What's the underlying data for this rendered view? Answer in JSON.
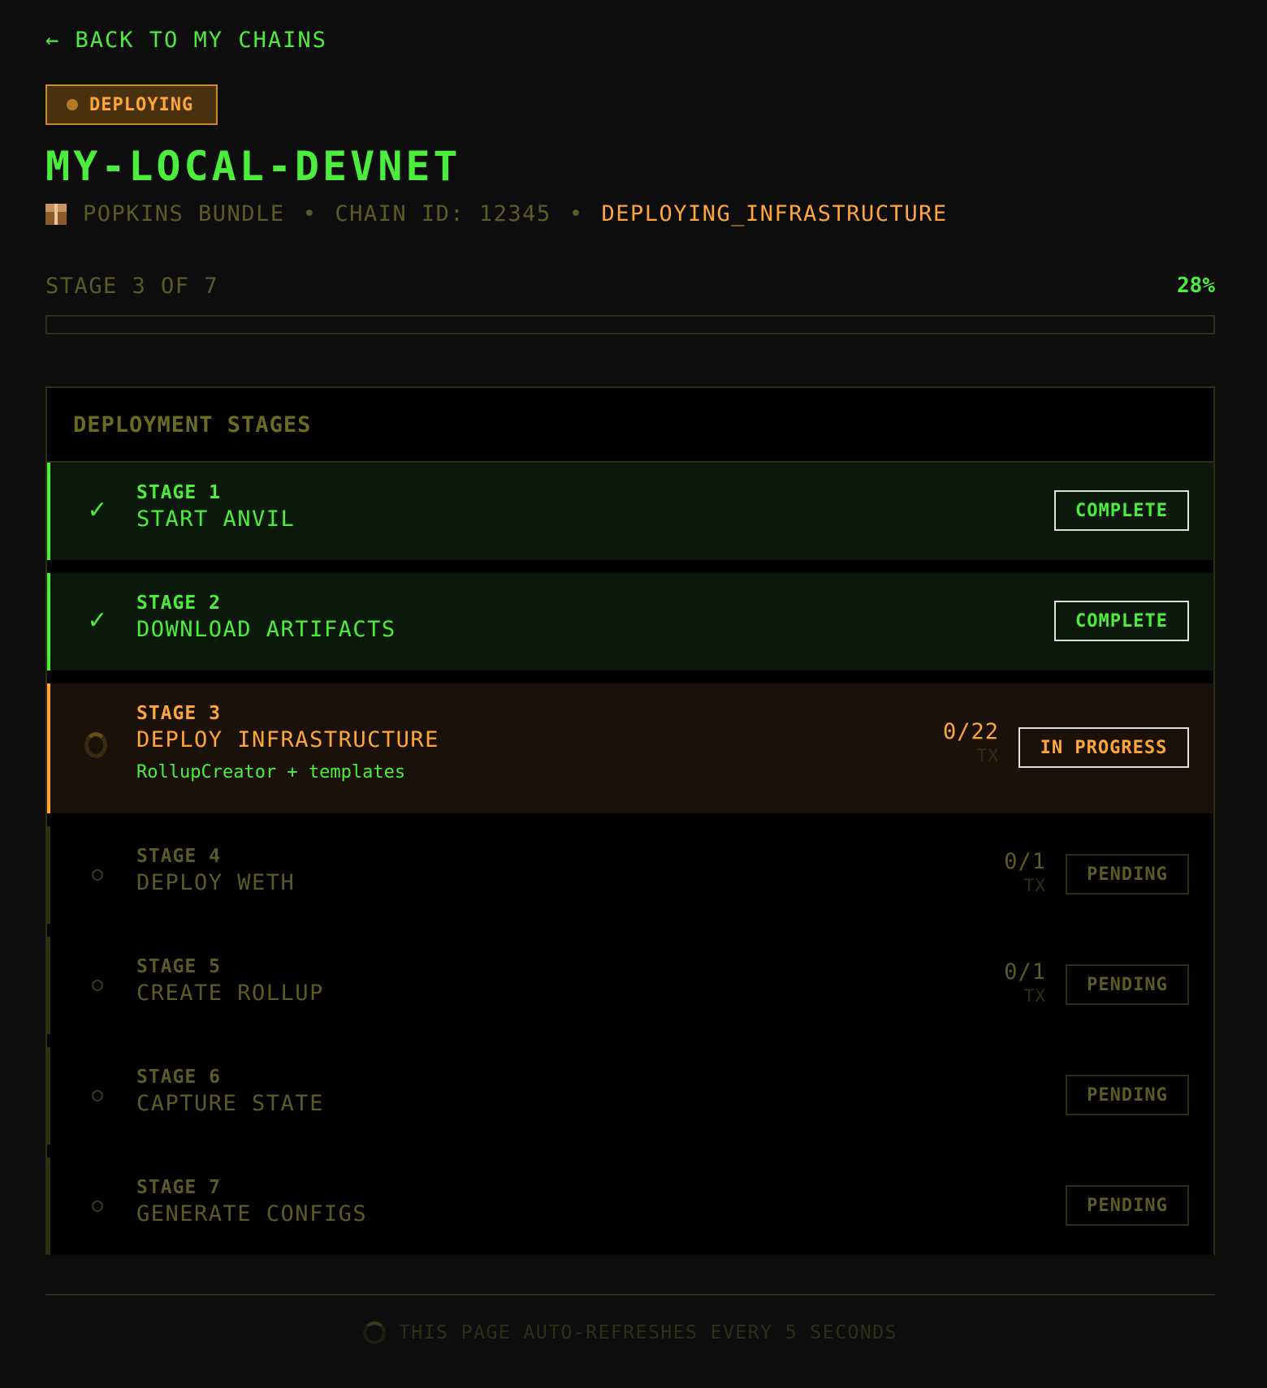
{
  "nav": {
    "back_label": "← BACK TO MY CHAINS"
  },
  "header": {
    "status_badge": "DEPLOYING",
    "title": "MY-LOCAL-DEVNET",
    "bundle": "POPKINS BUNDLE",
    "bundle_icon": "package-icon",
    "separator": "•",
    "chain_id": "CHAIN ID: 12345",
    "state": "DEPLOYING_INFRASTRUCTURE"
  },
  "progress": {
    "label": "STAGE 3 OF 7",
    "percent_label": "28%",
    "percent_value": 28
  },
  "stages_panel": {
    "title": "DEPLOYMENT STAGES",
    "stages": [
      {
        "number": "STAGE 1",
        "name": "START ANVIL",
        "status": "COMPLETE",
        "state": "done",
        "icon": "check-icon"
      },
      {
        "number": "STAGE 2",
        "name": "DOWNLOAD ARTIFACTS",
        "status": "COMPLETE",
        "state": "done",
        "icon": "check-icon"
      },
      {
        "number": "STAGE 3",
        "name": "DEPLOY INFRASTRUCTURE",
        "subtitle": "RollupCreator + templates",
        "tx": "0/22",
        "tx_unit": "TX",
        "status": "IN PROGRESS",
        "state": "active",
        "icon": "spinner-icon"
      },
      {
        "number": "STAGE 4",
        "name": "DEPLOY WETH",
        "tx": "0/1",
        "tx_unit": "TX",
        "status": "PENDING",
        "state": "pending",
        "icon": "circle-icon"
      },
      {
        "number": "STAGE 5",
        "name": "CREATE ROLLUP",
        "tx": "0/1",
        "tx_unit": "TX",
        "status": "PENDING",
        "state": "pending",
        "icon": "circle-icon"
      },
      {
        "number": "STAGE 6",
        "name": "CAPTURE STATE",
        "status": "PENDING",
        "state": "pending",
        "icon": "circle-icon"
      },
      {
        "number": "STAGE 7",
        "name": "GENERATE CONFIGS",
        "status": "PENDING",
        "state": "pending",
        "icon": "circle-icon"
      }
    ]
  },
  "footer": {
    "note": "THIS PAGE AUTO-REFRESHES EVERY 5 SECONDS",
    "icon": "refresh-spinner-icon"
  },
  "colors": {
    "background": "#0d0d0d",
    "green": "#4ded3e",
    "orange": "#ffa53a",
    "muted": "#5b5b25",
    "border": "#2f2f14"
  }
}
